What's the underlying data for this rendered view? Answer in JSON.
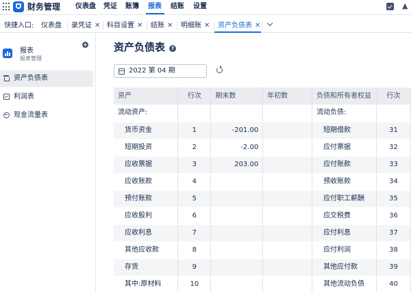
{
  "header": {
    "app_title": "财务管理",
    "nav": [
      "仪表盘",
      "凭证",
      "账簿",
      "报表",
      "结账",
      "设置"
    ],
    "active_nav": "报表"
  },
  "quick_access": {
    "label": "快捷入口:",
    "tabs": [
      {
        "label": "仪表盘",
        "closable": false
      },
      {
        "label": "录凭证",
        "closable": true
      },
      {
        "label": "科目设置",
        "closable": true
      },
      {
        "label": "结账",
        "closable": true
      },
      {
        "label": "明细账",
        "closable": true
      },
      {
        "label": "资产负债表",
        "closable": true
      }
    ],
    "close_glyph": "✕",
    "active_tab": "资产负债表"
  },
  "sidebar": {
    "title": "报表",
    "subtitle": "报表管理",
    "add_glyph": "+",
    "items": [
      {
        "label": "资产负债表",
        "icon": "bank-icon",
        "active": true
      },
      {
        "label": "利润表",
        "icon": "trend-icon",
        "active": false
      },
      {
        "label": "现金流量表",
        "icon": "cashflow-icon",
        "active": false
      }
    ]
  },
  "main": {
    "title": "资产负债表",
    "help_glyph": "?",
    "period": "2022 第 04 期"
  },
  "table": {
    "columns": [
      "资产",
      "行次",
      "期末数",
      "年初数",
      "负债和所有者权益",
      "行次"
    ],
    "rows": [
      {
        "asset": "流动资产:",
        "line": "",
        "end": "",
        "begin": "",
        "liab": "流动负债:",
        "liab_line": "",
        "header": true
      },
      {
        "asset": "货币资金",
        "line": "1",
        "end": "-201.00",
        "begin": "",
        "liab": "短期借款",
        "liab_line": "31"
      },
      {
        "asset": "短期投资",
        "line": "2",
        "end": "-2.00",
        "begin": "",
        "liab": "应付票据",
        "liab_line": "32"
      },
      {
        "asset": "应收票据",
        "line": "3",
        "end": "203.00",
        "begin": "",
        "liab": "应付账款",
        "liab_line": "33"
      },
      {
        "asset": "应收账款",
        "line": "4",
        "end": "",
        "begin": "",
        "liab": "预收账款",
        "liab_line": "34"
      },
      {
        "asset": "预付账款",
        "line": "5",
        "end": "",
        "begin": "",
        "liab": "应付职工薪酬",
        "liab_line": "35"
      },
      {
        "asset": "应收股利",
        "line": "6",
        "end": "",
        "begin": "",
        "liab": "应交税费",
        "liab_line": "36"
      },
      {
        "asset": "应收利息",
        "line": "7",
        "end": "",
        "begin": "",
        "liab": "应付利息",
        "liab_line": "37"
      },
      {
        "asset": "其他应收款",
        "line": "8",
        "end": "",
        "begin": "",
        "liab": "应付利润",
        "liab_line": "38"
      },
      {
        "asset": "存货",
        "line": "9",
        "end": "",
        "begin": "",
        "liab": "其他应付款",
        "liab_line": "39"
      },
      {
        "asset": "其中:原材料",
        "line": "10",
        "end": "",
        "begin": "",
        "liab": "其他流动负债",
        "liab_line": "40"
      }
    ]
  },
  "colors": {
    "accent": "#1868db",
    "text": "#172b4d",
    "muted": "#42526e",
    "row_alt": "#f4f5f7",
    "header_bg": "#ebecf0"
  }
}
